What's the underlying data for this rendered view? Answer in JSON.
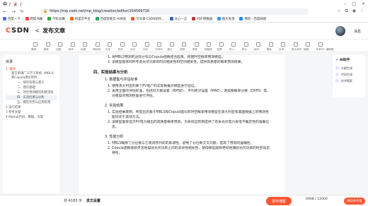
{
  "browser": {
    "logo": "中 ♪ 🀄 ♪",
    "url": "https://mp.csdn.net/mp_blog/creation/editor/154569716",
    "bookmarks": [
      {
        "label": "百度一下",
        "color": "#4e6ef2"
      },
      {
        "label": "爬取书籍",
        "color": "#e44"
      },
      {
        "label": "学科竞赛",
        "color": "#3a3"
      },
      {
        "label": "阿里云平台",
        "color": "#f60"
      },
      {
        "label": "百度智能云-AI体验",
        "color": "#2a6"
      },
      {
        "label": "写文章-CSDN创作...",
        "color": "#fc5531"
      },
      {
        "label": "文心一言",
        "color": "#36c"
      },
      {
        "label": "PDF转换器",
        "color": "#c33"
      },
      {
        "label": "图片处理",
        "color": "#39f"
      },
      {
        "label": "我的—百度网盘",
        "color": "#28f"
      }
    ]
  },
  "header": {
    "logo_c": "C",
    "logo_rest": "SDN",
    "back": "<",
    "title": "发布文章",
    "messages": "消息"
  },
  "toolbar": {
    "labels": [
      "撤销",
      "重做",
      "加粗",
      "斜体",
      "标题",
      "删除线",
      "无序",
      "有序",
      "待办",
      "引用",
      "代码块",
      "图片",
      "视频",
      "表格",
      "超链接",
      "投票",
      "导入",
      "导出",
      "保存",
      "模版",
      "目录",
      "语法说明",
      "隐藏",
      "专家MC 编辑器"
    ]
  },
  "toc": {
    "title": "目录",
    "items": [
      {
        "text": "1. 概述",
        "level": 0,
        "active": true
      },
      {
        "text": "基于单调广义学习系统（MBLS）和Copula理论的时...",
        "level": 1
      },
      {
        "text": "一、研究背景与意义",
        "level": 2
      },
      {
        "text": "二、理论基础",
        "level": 2
      },
      {
        "text": "三、时空预测模型构建流程",
        "level": 2
      },
      {
        "text": "四、实验结果与分析",
        "level": 2,
        "highlight": true
      },
      {
        "text": "五、模型优势与应用前景",
        "level": 2
      },
      {
        "text": "2 运行结果",
        "level": 0
      },
      {
        "text": "3 参考文献",
        "level": 0
      },
      {
        "text": "4 Matlab代码、数据、文章",
        "level": 0
      }
    ]
  },
  "article": {
    "lines": [
      {
        "type": "li",
        "text": "1. 将MBLS预测的边际分布与Copula函数结合起来，构建时空概率预测模型。"
      },
      {
        "type": "li",
        "text": "2. 该模型能够同时考虑光伏功率的时间相关性和空间相关性，提供高质量的概率预测结果。"
      },
      {
        "type": "h3",
        "text": "四、实验结果与分析"
      },
      {
        "type": "h4",
        "text": "1. 数据集与评估标准"
      },
      {
        "type": "li",
        "text": "1. 使用澳大利亚的某个PV电厂的实际数据对模型进行验证。"
      },
      {
        "type": "li",
        "text": "2. 采用全面的评估标准，包括均方根误差（RMSE）、平均绝对误差（MAE），连续秩概率分数（CRPS）等，对模型的预测性能进行评估。"
      },
      {
        "type": "h4",
        "text": "2. 实验结果"
      },
      {
        "type": "li",
        "text": "1. 实验结果表明，所提出的基于MBLS和Copula理论的时空概率预测模型在澳大利亚和美国数据上的预测性能均优于其他方法。"
      },
      {
        "type": "li",
        "text": "2. 该模型能够显示PV电力输出的高质量概率预测，为系统运营商提供了有关光伏电力发电不确定性的准确信息。"
      },
      {
        "type": "h4",
        "text": "3. 性能分析"
      },
      {
        "type": "li",
        "text": "1. MBLS确保了分位数与它观测序列间的单调性，避免了分位数交叉问题，提高了预测的准确性。"
      },
      {
        "type": "li",
        "text": "2. Copula函数能够灵活地描述光伏功率之间的非线性相关性，使得模型能够更好地捕捉光伏功率的时空动态特性。"
      }
    ]
  },
  "ai_panel": {
    "title": "AI助手",
    "items": [
      "大纲生成",
      "代码生成",
      "技术搜索"
    ]
  },
  "bottom": {
    "word_count": "共 4183 字",
    "publish_settings": "发文设置",
    "publish_button": "发布博客",
    "char_counter": "0008 / 12000",
    "pill": "阅读并充电"
  }
}
